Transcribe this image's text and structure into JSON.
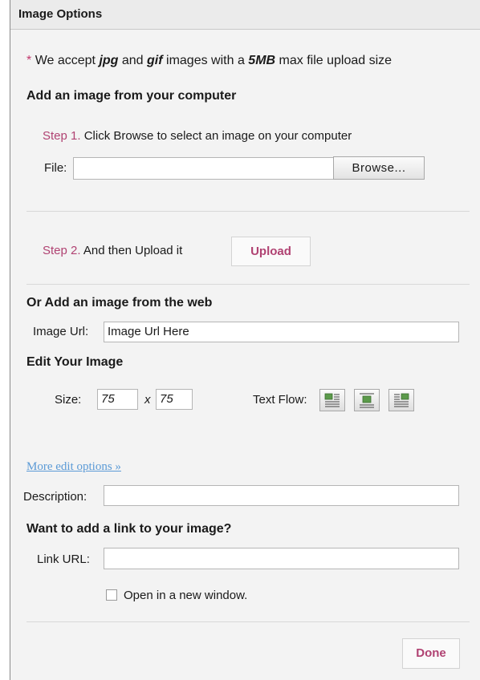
{
  "header": {
    "title": "Image Options"
  },
  "note": {
    "prefix": "We accept ",
    "fmt1": "jpg",
    "and": " and ",
    "fmt2": "gif",
    "mid": " images with a ",
    "size": "5MB",
    "suffix": " max file upload size"
  },
  "computer_section": {
    "heading": "Add an image from your computer",
    "step1_label": "Step 1.",
    "step1_text": "Click Browse to select an image on your computer",
    "file_label": "File:",
    "file_value": "",
    "browse_label": "Browse...",
    "step2_label": "Step 2.",
    "step2_text": "And then Upload it",
    "upload_label": "Upload"
  },
  "web_section": {
    "heading": "Or Add an image from the web",
    "url_label": "Image Url:",
    "url_value": "Image Url Here"
  },
  "edit_section": {
    "heading": "Edit Your Image",
    "size_label": "Size:",
    "width_value": "75",
    "times": "x",
    "height_value": "75",
    "text_flow_label": "Text Flow:",
    "text_flow_icons": [
      "align-left-icon",
      "align-center-icon",
      "align-right-icon"
    ]
  },
  "more_options": "More edit options »",
  "description": {
    "label": "Description:",
    "value": ""
  },
  "link_section": {
    "heading": "Want to add a link to your image?",
    "url_label": "Link URL:",
    "url_value": "",
    "new_window_label": "Open in a new window.",
    "new_window_checked": false
  },
  "done_label": "Done",
  "colors": {
    "accent": "#b04272",
    "link": "#5b9ad6",
    "panel": "#f3f3f3"
  }
}
